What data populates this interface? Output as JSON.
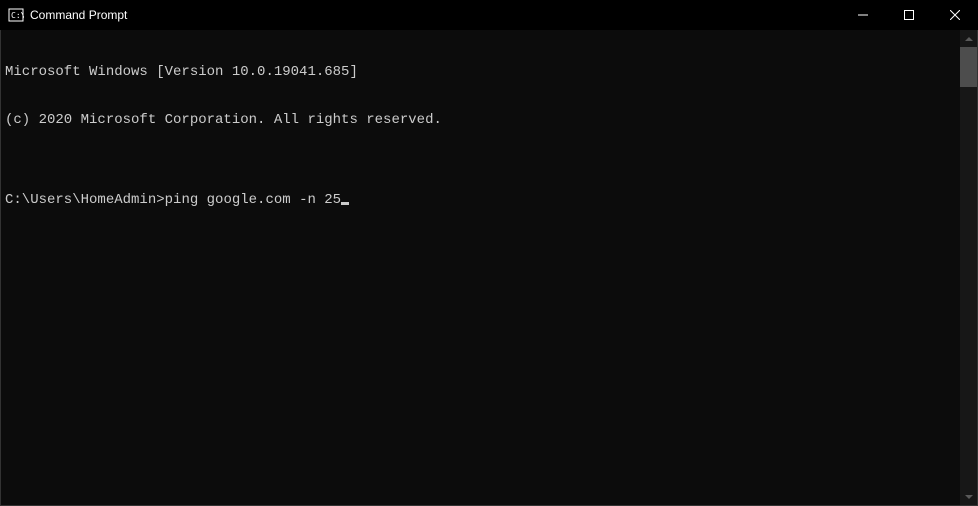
{
  "titlebar": {
    "title": "Command Prompt"
  },
  "console": {
    "line1": "Microsoft Windows [Version 10.0.19041.685]",
    "line2": "(c) 2020 Microsoft Corporation. All rights reserved.",
    "blank": "",
    "prompt": "C:\\Users\\HomeAdmin>",
    "command": "ping google.com -n 25"
  }
}
